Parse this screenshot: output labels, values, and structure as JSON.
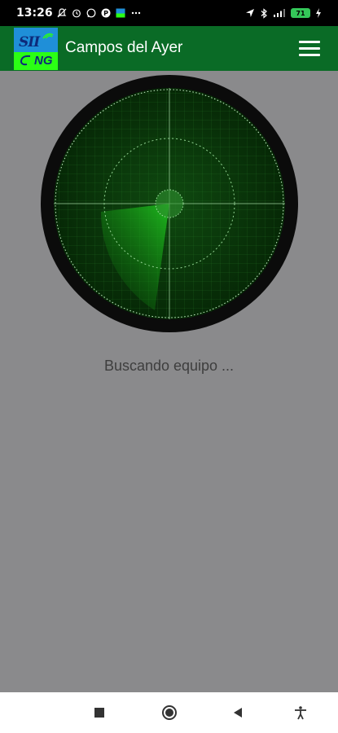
{
  "status_bar": {
    "time": "13:26",
    "battery": "71",
    "left_icons": [
      "mute-icon",
      "alarm-icon",
      "whatsapp-icon",
      "p-icon",
      "app-icon",
      "more-dots-icon"
    ],
    "right_icons": [
      "location-icon",
      "bluetooth-icon",
      "signal-icon",
      "battery-icon",
      "charging-icon"
    ]
  },
  "app_bar": {
    "logo_text_top": "SII",
    "logo_text_bottom": "NG",
    "title": "Campos del Ayer",
    "menu_icon": "hamburger-menu-icon"
  },
  "radar": {
    "icon": "radar-scanner-icon",
    "colors": {
      "bezel": "#0b0b0b",
      "screen": "#0a3d0a",
      "grid": "#2f8a2f",
      "sweep": "#1fc41f"
    }
  },
  "main": {
    "status_text": "Buscando equipo ..."
  },
  "nav_bar": {
    "icons": [
      "recents-square-icon",
      "home-circle-icon",
      "back-triangle-icon",
      "accessibility-icon"
    ]
  }
}
